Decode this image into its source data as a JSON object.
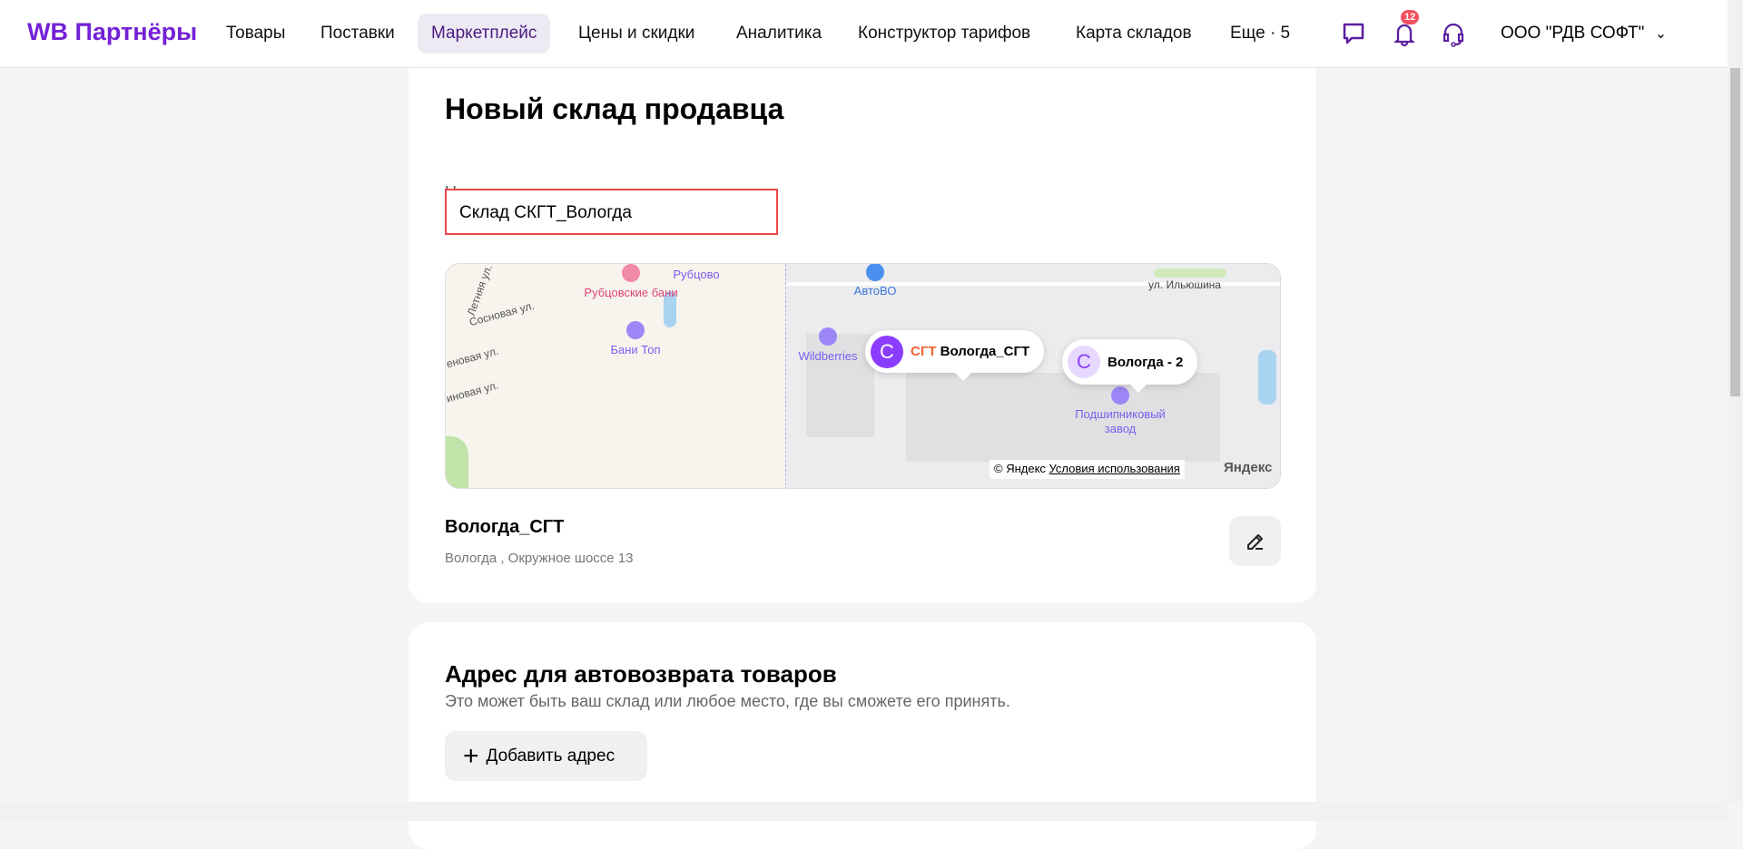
{
  "header": {
    "logo": "WB Партнёры",
    "nav": [
      "Товары",
      "Поставки",
      "Маркетплейс",
      "Цены и скидки",
      "Аналитика",
      "Конструктор тарифов",
      "Карта складов",
      "Еще · 5"
    ],
    "active_nav": "Маркетплейс",
    "notifications_count": "12",
    "org_name": "ООО \"РДВ СОФТ\""
  },
  "form": {
    "title": "Новый склад продавца",
    "name_label": "Название склада",
    "name_value": "Склад СКГТ_Вологда"
  },
  "map": {
    "places": [
      "Рубцовские бани",
      "Рубцово",
      "Бани Топ",
      "Wildberries",
      "АвтоВО",
      "ул. Ильюшина",
      "Подшипниковый",
      "завод"
    ],
    "streets": [
      "Летняя ул.",
      "Сосновая ул.",
      "еновая ул.",
      "иновая ул."
    ],
    "popup1": {
      "initial": "С",
      "prefix": "СГТ",
      "name": "Вологда_СГТ"
    },
    "popup2": {
      "initial": "С",
      "name": "Вологда - 2"
    },
    "copyright": "© Яндекс",
    "terms": "Условия использования",
    "brand": "Яндекс"
  },
  "warehouse": {
    "name": "Вологда_СГТ",
    "address": "Вологда , Окружное шоссе 13"
  },
  "return": {
    "title": "Адрес для автовозврата товаров",
    "subtitle": "Это может быть ваш склад или любое место, где вы сможете его принять.",
    "add_button": "Добавить адрес"
  },
  "colors": {
    "brand": "#7321d6",
    "highlight": "#f04848",
    "badge": "#f5515f"
  }
}
